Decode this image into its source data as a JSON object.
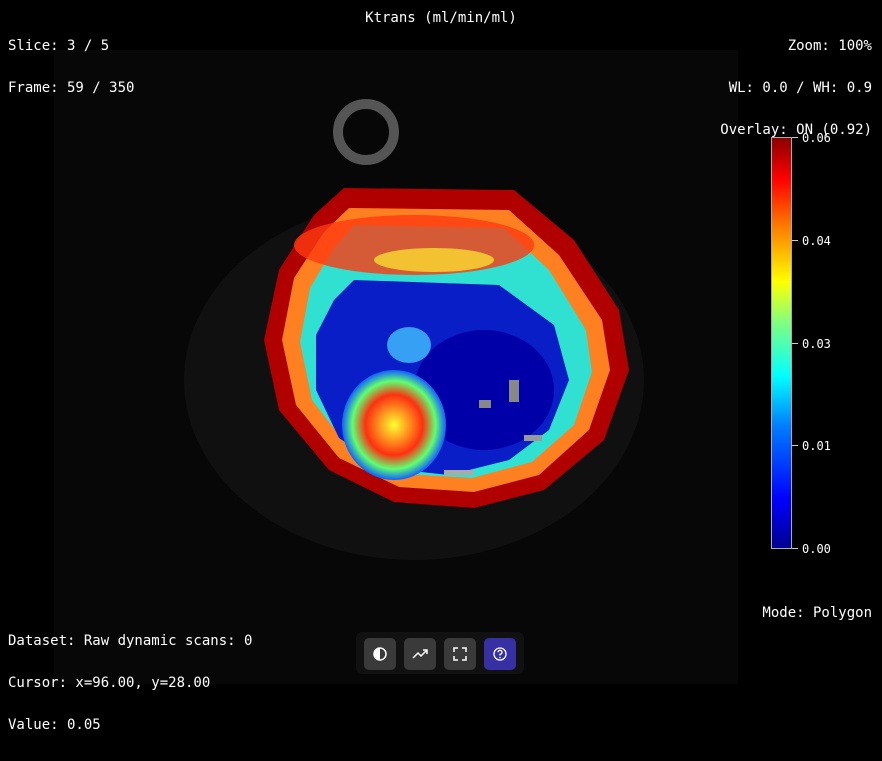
{
  "overlay": {
    "slice": "Slice: 3 / 5",
    "frame": "Frame: 59 / 350",
    "map_title": "Ktrans (ml/min/ml)",
    "zoom": "Zoom: 100%",
    "window_level": "WL: 0.0 / WH: 0.9",
    "overlay_status": "Overlay: ON (0.92)",
    "dataset": "Dataset: Raw dynamic scans: 0",
    "cursor": "Cursor: x=96.00, y=28.00",
    "value": "Value: 0.05",
    "mode": "Mode: Polygon"
  },
  "colorbar": {
    "ticks": [
      "0.06",
      "0.04",
      "0.03",
      "0.01",
      "0.00"
    ],
    "colors": [
      "#00008f",
      "#0000ff",
      "#0080ff",
      "#00ffff",
      "#80ff80",
      "#ffff00",
      "#ff8000",
      "#ff0000",
      "#8b0000"
    ]
  },
  "toolbar": {
    "buttons": [
      {
        "icon": "contrast-icon",
        "active": false
      },
      {
        "icon": "trend-icon",
        "active": false
      },
      {
        "icon": "fullscreen-icon",
        "active": false
      },
      {
        "icon": "help-icon",
        "active": true
      }
    ],
    "accent": "#3730a3"
  }
}
